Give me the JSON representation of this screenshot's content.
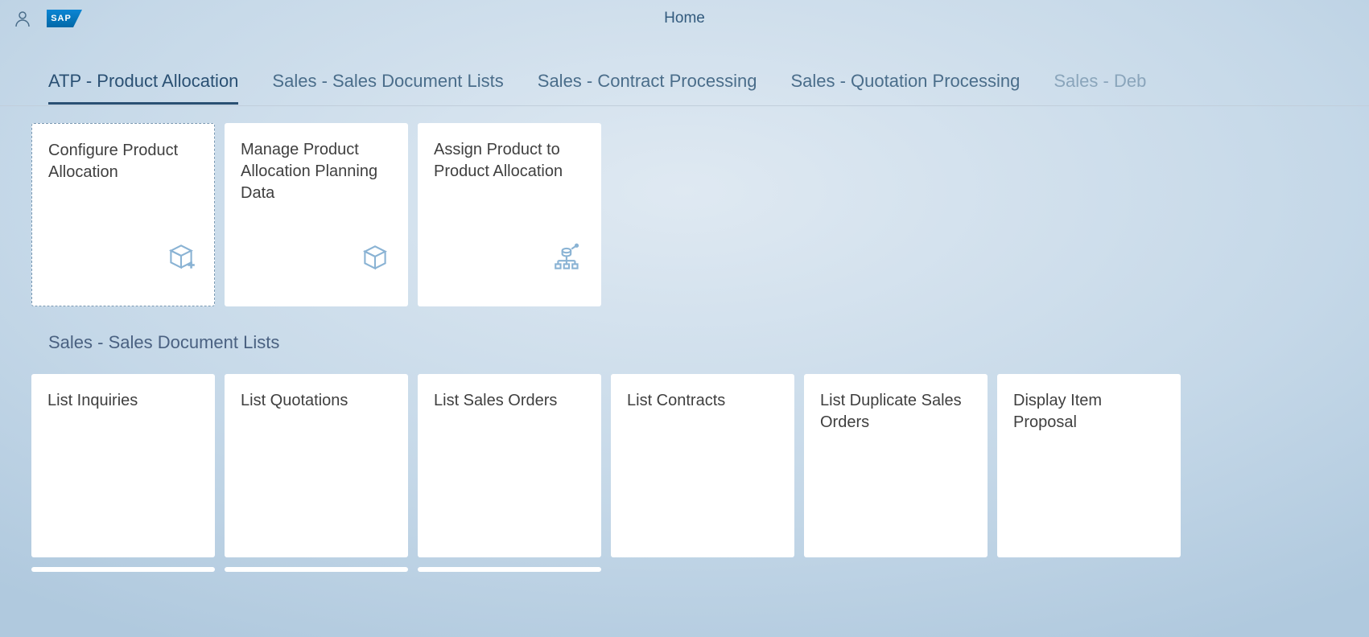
{
  "header": {
    "title": "Home",
    "logo_text": "SAP"
  },
  "tabs": [
    {
      "label": "ATP - Product Allocation",
      "active": true
    },
    {
      "label": "Sales - Sales Document Lists",
      "active": false
    },
    {
      "label": "Sales - Contract Processing",
      "active": false
    },
    {
      "label": "Sales - Quotation Processing",
      "active": false
    },
    {
      "label": "Sales - Deb",
      "active": false
    }
  ],
  "sections": [
    {
      "heading": "",
      "tiles": [
        {
          "title": "Configure Product Allocation",
          "icon": "box-plus",
          "selected": true
        },
        {
          "title": "Manage Product Allocation Planning Data",
          "icon": "box",
          "selected": false
        },
        {
          "title": "Assign Product to Product Allocation",
          "icon": "hierarchy",
          "selected": false
        }
      ]
    },
    {
      "heading": "Sales - Sales Document Lists",
      "tiles": [
        {
          "title": "List Inquiries",
          "icon": "",
          "selected": false
        },
        {
          "title": "List Quotations",
          "icon": "",
          "selected": false
        },
        {
          "title": "List Sales Orders",
          "icon": "",
          "selected": false
        },
        {
          "title": "List Contracts",
          "icon": "",
          "selected": false
        },
        {
          "title": "List Duplicate Sales Orders",
          "icon": "",
          "selected": false
        },
        {
          "title": "Display Item Proposal",
          "icon": "",
          "selected": false
        }
      ]
    }
  ]
}
